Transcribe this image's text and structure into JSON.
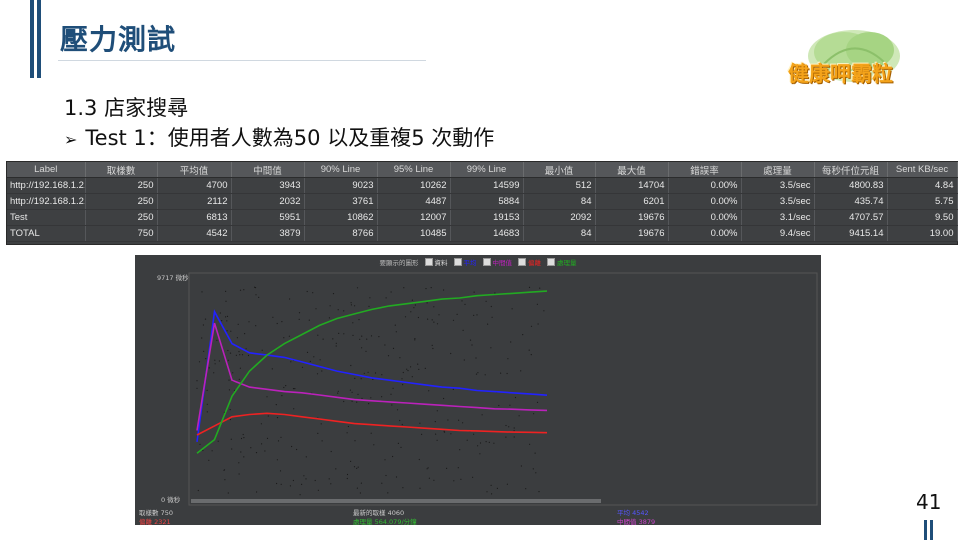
{
  "slide": {
    "title": "壓力測試",
    "subtitle": "1.3 店家搜尋",
    "bullet_marker": "➢",
    "bullet_text": "Test 1：使用者人數為50 以及重複5 次動作",
    "page_number": "41",
    "logo_text": "健康呷霸粒"
  },
  "colors": {
    "title": "#1f4e79",
    "logo": "#f4a31a",
    "chart_avg": "#2222ff",
    "chart_median": "#bb22bb",
    "chart_deviation": "#ee2222",
    "chart_throughput": "#22aa22"
  },
  "table": {
    "headers": [
      "Label",
      "取樣數",
      "平均值",
      "中間值",
      "90% Line",
      "95% Line",
      "99% Line",
      "最小值",
      "最大值",
      "錯誤率",
      "處理量",
      "每秒仟位元組",
      "Sent KB/sec"
    ],
    "rows": [
      [
        "http://192.168.1.2...",
        "250",
        "4700",
        "3943",
        "9023",
        "10262",
        "14599",
        "512",
        "14704",
        "0.00%",
        "3.5/sec",
        "4800.83",
        "4.84"
      ],
      [
        "http://192.168.1.2...",
        "250",
        "2112",
        "2032",
        "3761",
        "4487",
        "5884",
        "84",
        "6201",
        "0.00%",
        "3.5/sec",
        "435.74",
        "5.75"
      ],
      [
        "Test",
        "250",
        "6813",
        "5951",
        "10862",
        "12007",
        "19153",
        "2092",
        "19676",
        "0.00%",
        "3.1/sec",
        "4707.57",
        "9.50"
      ],
      [
        "TOTAL",
        "750",
        "4542",
        "3879",
        "8766",
        "10485",
        "14683",
        "84",
        "19676",
        "0.00%",
        "9.4/sec",
        "9415.14",
        "19.00"
      ]
    ]
  },
  "chart_data": {
    "type": "line",
    "legend_title": "要顯示的圖形",
    "legend": [
      {
        "name": "資料",
        "color": "#dddddd"
      },
      {
        "name": "平均",
        "color": "#2222ff"
      },
      {
        "name": "中間值",
        "color": "#bb22bb"
      },
      {
        "name": "偏離",
        "color": "#ee2222"
      },
      {
        "name": "處理量",
        "color": "#22aa22"
      }
    ],
    "y_top_label": "9717 微秒",
    "y_bottom_label": "0 微秒",
    "ylim": [
      0,
      9717
    ],
    "x": [
      0,
      5,
      10,
      15,
      20,
      25,
      30,
      35,
      40,
      45,
      50,
      55,
      60,
      65,
      70,
      75,
      80,
      85,
      90,
      95,
      100
    ],
    "series": [
      {
        "name": "平均",
        "color": "#2222ff",
        "values": [
          2500,
          8200,
          6800,
          6400,
          6300,
          6200,
          6000,
          5800,
          5600,
          5450,
          5300,
          5200,
          5100,
          5000,
          4900,
          4850,
          4750,
          4700,
          4650,
          4600,
          4542
        ]
      },
      {
        "name": "中間值",
        "color": "#bb22bb",
        "values": [
          3000,
          7700,
          5200,
          4900,
          4800,
          4700,
          4650,
          4550,
          4450,
          4350,
          4300,
          4250,
          4200,
          4150,
          4100,
          4050,
          4000,
          3950,
          3930,
          3900,
          3879
        ]
      },
      {
        "name": "偏離",
        "color": "#ee2222",
        "values": [
          2800,
          3200,
          3600,
          3700,
          3750,
          3700,
          3600,
          3500,
          3400,
          3300,
          3250,
          3200,
          3150,
          3100,
          3050,
          3000,
          2980,
          2950,
          2930,
          2920,
          2900
        ]
      },
      {
        "name": "處理量",
        "color": "#22aa22",
        "values": [
          2000,
          2600,
          4500,
          5600,
          6300,
          6800,
          7200,
          7600,
          7900,
          8100,
          8300,
          8450,
          8550,
          8650,
          8750,
          8800,
          8900,
          8950,
          9000,
          9050,
          9100
        ]
      }
    ],
    "stats": {
      "samples_label": "取樣數",
      "samples_value": "750",
      "latest_label": "最新的取樣",
      "latest_value": "4060",
      "avg_label": "平均",
      "avg_value": "4542",
      "deviation_label": "偏離",
      "deviation_value": "2321",
      "throughput_label": "處理量",
      "throughput_value": "564.079/分鐘",
      "median_label": "中間值",
      "median_value": "3879"
    }
  }
}
